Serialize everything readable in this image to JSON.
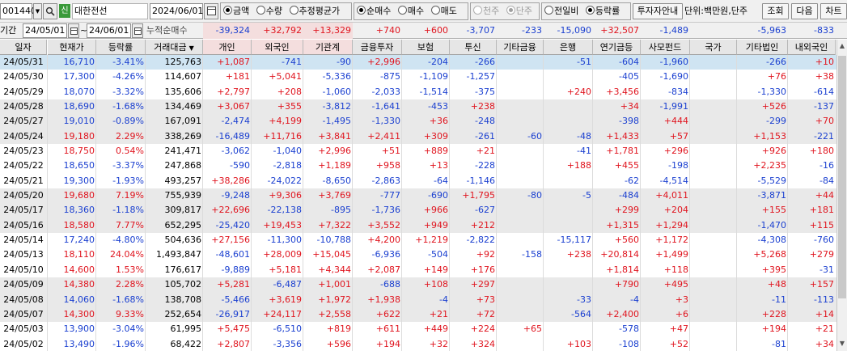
{
  "colors": {
    "up": "#e0141e",
    "down": "#1a3fd0",
    "header_bg": "#e6e6e6",
    "selected_row": "#cfe4f2"
  },
  "toolbar": {
    "code": "001440",
    "search_icon": "search-icon",
    "badge": "신",
    "name": "대한전선",
    "date": "2024/06/01",
    "radio_group1": [
      "금액",
      "수량",
      "추정평균가"
    ],
    "radio_group2": [
      "순매수",
      "매수",
      "매도"
    ],
    "radio_group3": [
      "천주",
      "단주"
    ],
    "radio_group4": [
      "전일비",
      "등락률"
    ],
    "investor_btn": "투자자안내",
    "unit": "단위:백만원,단주",
    "query_btn": "조회",
    "next_btn": "다음",
    "chart_btn": "차트"
  },
  "period": {
    "label": "기간",
    "from": "24/05/01",
    "to": "24/06/01",
    "cum_label": "누적순매수"
  },
  "summary": [
    "-39,324",
    "+32,792",
    "+13,329",
    "+740",
    "+600",
    "-3,707",
    "-233",
    "-15,090",
    "+32,507",
    "-1,489",
    "",
    "-5,963",
    "-833"
  ],
  "columns": [
    "일자",
    "현재가",
    "등락률",
    "거래대금",
    "개인",
    "외국인",
    "기관계",
    "금융투자",
    "보험",
    "투신",
    "기타금융",
    "은행",
    "연기금등",
    "사모펀드",
    "국가",
    "기타법인",
    "내외국인"
  ],
  "sort_marker": "▼",
  "rows": [
    [
      "24/05/31",
      "16,710",
      "-3.41%",
      "125,763",
      "+1,087",
      "-741",
      "-90",
      "+2,996",
      "-204",
      "-266",
      "",
      "-51",
      "-604",
      "-1,960",
      "",
      "-266",
      "+10"
    ],
    [
      "24/05/30",
      "17,300",
      "-4.26%",
      "114,607",
      "+181",
      "+5,041",
      "-5,336",
      "-875",
      "-1,109",
      "-1,257",
      "",
      "",
      "-405",
      "-1,690",
      "",
      "+76",
      "+38"
    ],
    [
      "24/05/29",
      "18,070",
      "-3.32%",
      "135,606",
      "+2,797",
      "+208",
      "-1,060",
      "-2,033",
      "-1,514",
      "-375",
      "",
      "+240",
      "+3,456",
      "-834",
      "",
      "-1,330",
      "-614"
    ],
    [
      "24/05/28",
      "18,690",
      "-1.68%",
      "134,469",
      "+3,067",
      "+355",
      "-3,812",
      "-1,641",
      "-453",
      "+238",
      "",
      "",
      "+34",
      "-1,991",
      "",
      "+526",
      "-137"
    ],
    [
      "24/05/27",
      "19,010",
      "-0.89%",
      "167,091",
      "-2,474",
      "+4,199",
      "-1,495",
      "-1,330",
      "+36",
      "-248",
      "",
      "",
      "-398",
      "+444",
      "",
      "-299",
      "+70"
    ],
    [
      "24/05/24",
      "19,180",
      "2.29%",
      "338,269",
      "-16,489",
      "+11,716",
      "+3,841",
      "+2,411",
      "+309",
      "-261",
      "-60",
      "-48",
      "+1,433",
      "+57",
      "",
      "+1,153",
      "-221"
    ],
    [
      "24/05/23",
      "18,750",
      "0.54%",
      "241,471",
      "-3,062",
      "-1,040",
      "+2,996",
      "+51",
      "+889",
      "+21",
      "",
      "-41",
      "+1,781",
      "+296",
      "",
      "+926",
      "+180"
    ],
    [
      "24/05/22",
      "18,650",
      "-3.37%",
      "247,868",
      "-590",
      "-2,818",
      "+1,189",
      "+958",
      "+13",
      "-228",
      "",
      "+188",
      "+455",
      "-198",
      "",
      "+2,235",
      "-16"
    ],
    [
      "24/05/21",
      "19,300",
      "-1.93%",
      "493,257",
      "+38,286",
      "-24,022",
      "-8,650",
      "-2,863",
      "-64",
      "-1,146",
      "",
      "",
      "-62",
      "-4,514",
      "",
      "-5,529",
      "-84"
    ],
    [
      "24/05/20",
      "19,680",
      "7.19%",
      "755,939",
      "-9,248",
      "+9,306",
      "+3,769",
      "-777",
      "-690",
      "+1,795",
      "-80",
      "-5",
      "-484",
      "+4,011",
      "",
      "-3,871",
      "+44"
    ],
    [
      "24/05/17",
      "18,360",
      "-1.18%",
      "309,817",
      "+22,696",
      "-22,138",
      "-895",
      "-1,736",
      "+966",
      "-627",
      "",
      "",
      "+299",
      "+204",
      "",
      "+155",
      "+181"
    ],
    [
      "24/05/16",
      "18,580",
      "7.77%",
      "652,295",
      "-25,420",
      "+19,453",
      "+7,322",
      "+3,552",
      "+949",
      "+212",
      "",
      "",
      "+1,315",
      "+1,294",
      "",
      "-1,470",
      "+115"
    ],
    [
      "24/05/14",
      "17,240",
      "-4.80%",
      "504,636",
      "+27,156",
      "-11,300",
      "-10,788",
      "+4,200",
      "+1,219",
      "-2,822",
      "",
      "-15,117",
      "+560",
      "+1,172",
      "",
      "-4,308",
      "-760"
    ],
    [
      "24/05/13",
      "18,110",
      "24.04%",
      "1,493,847",
      "-48,601",
      "+28,009",
      "+15,045",
      "-6,936",
      "-504",
      "+92",
      "-158",
      "+238",
      "+20,814",
      "+1,499",
      "",
      "+5,268",
      "+279"
    ],
    [
      "24/05/10",
      "14,600",
      "1.53%",
      "176,617",
      "-9,889",
      "+5,181",
      "+4,344",
      "+2,087",
      "+149",
      "+176",
      "",
      "",
      "+1,814",
      "+118",
      "",
      "+395",
      "-31"
    ],
    [
      "24/05/09",
      "14,380",
      "2.28%",
      "105,702",
      "+5,281",
      "-6,487",
      "+1,001",
      "-688",
      "+108",
      "+297",
      "",
      "",
      "+790",
      "+495",
      "",
      "+48",
      "+157"
    ],
    [
      "24/05/08",
      "14,060",
      "-1.68%",
      "138,708",
      "-5,466",
      "+3,619",
      "+1,972",
      "+1,938",
      "-4",
      "+73",
      "",
      "-33",
      "-4",
      "+3",
      "",
      "-11",
      "-113"
    ],
    [
      "24/05/07",
      "14,300",
      "9.33%",
      "252,654",
      "-26,917",
      "+24,117",
      "+2,558",
      "+622",
      "+21",
      "+72",
      "",
      "-564",
      "+2,400",
      "+6",
      "",
      "+228",
      "+14"
    ],
    [
      "24/05/03",
      "13,900",
      "-3.04%",
      "61,995",
      "+5,475",
      "-6,510",
      "+819",
      "+611",
      "+449",
      "+224",
      "+65",
      "",
      "-578",
      "+47",
      "",
      "+194",
      "+21"
    ],
    [
      "24/05/02",
      "13,490",
      "-1.96%",
      "68,422",
      "+2,807",
      "-3,356",
      "+596",
      "+194",
      "+32",
      "+324",
      "",
      "+103",
      "-108",
      "+52",
      "",
      "-81",
      "+34"
    ]
  ]
}
